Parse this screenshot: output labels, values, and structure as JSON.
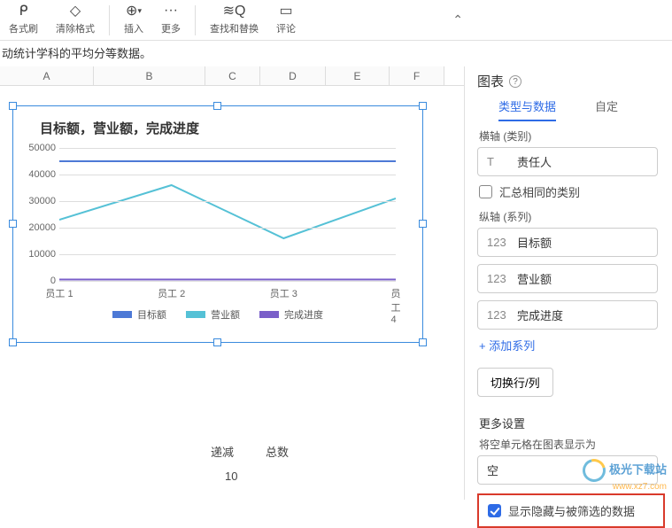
{
  "toolbar": {
    "format_brush": "各式刷",
    "clear_format": "清除格式",
    "insert": "插入",
    "more": "更多",
    "find_replace": "查找和替换",
    "comment": "评论"
  },
  "description": "动统计学科的平均分等数据。",
  "columns": [
    "A",
    "B",
    "C",
    "D",
    "E",
    "F"
  ],
  "bottom_cells": {
    "label1": "递减",
    "label2": "总数",
    "value": "10"
  },
  "panel": {
    "title": "图表",
    "tab_type_data": "类型与数据",
    "tab_custom": "自定",
    "x_axis_label": "横轴 (类别)",
    "x_field_prefix": "T",
    "x_field": "责任人",
    "aggregate_same": "汇总相同的类别",
    "y_axis_label": "纵轴 (系列)",
    "series_prefix": "123",
    "series": [
      "目标额",
      "营业额",
      "完成进度"
    ],
    "add_series": "+ 添加系列",
    "swap_btn": "切换行/列",
    "more_settings": "更多设置",
    "empty_cell_label": "将空单元格在图表显示为",
    "empty_option": "空",
    "show_hidden": "显示隐藏与被筛选的数据"
  },
  "chart_data": {
    "type": "line",
    "title": "目标额，营业额，完成进度",
    "categories": [
      "员工 1",
      "员工 2",
      "员工 3",
      "员工 4"
    ],
    "series": [
      {
        "name": "目标额",
        "color": "#4d79d6",
        "values": [
          45000,
          45000,
          45000,
          45000
        ]
      },
      {
        "name": "营业额",
        "color": "#55c1d6",
        "values": [
          23000,
          36000,
          16000,
          31000
        ]
      },
      {
        "name": "完成进度",
        "color": "#7a5fc9",
        "values": [
          500,
          500,
          500,
          500
        ]
      }
    ],
    "ylim": [
      0,
      50000
    ],
    "yticks": [
      0,
      10000,
      20000,
      30000,
      40000,
      50000
    ]
  },
  "watermark": {
    "line1": "极光下载站",
    "line2": "www.xz7.com"
  }
}
